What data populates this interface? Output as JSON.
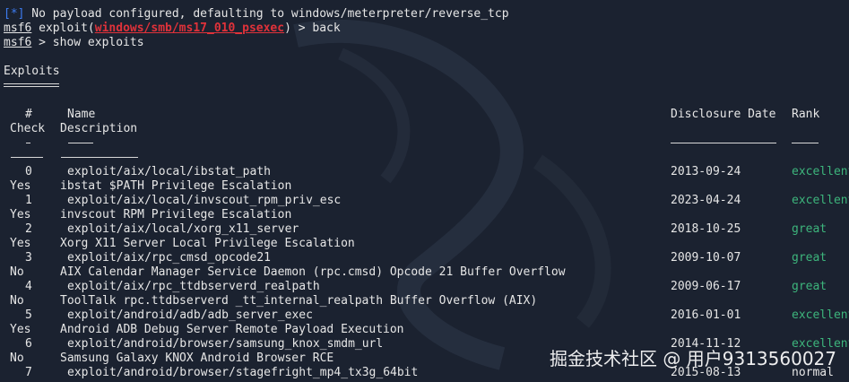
{
  "terminal": {
    "line1": {
      "marker": "[*]",
      "text": " No payload configured, defaulting to windows/meterpreter/reverse_tcp"
    },
    "line2": {
      "prompt": "msf6",
      "pre": " exploit(",
      "module": "windows/smb/ms17_010_psexec",
      "post": ") > back"
    },
    "line3": {
      "prompt": "msf6",
      "text": " > show exploits"
    },
    "section_title": "Exploits"
  },
  "table": {
    "headers": {
      "num": "#",
      "check": "Check",
      "name": "Name",
      "description": "Description",
      "date": "Disclosure Date",
      "rank": "Rank"
    },
    "rows": [
      {
        "num": "0",
        "name": "exploit/aix/local/ibstat_path",
        "date": "2013-09-24",
        "rank": "excellent",
        "check": "Yes",
        "description": "ibstat $PATH Privilege Escalation"
      },
      {
        "num": "1",
        "name": "exploit/aix/local/invscout_rpm_priv_esc",
        "date": "2023-04-24",
        "rank": "excellent",
        "check": "Yes",
        "description": "invscout RPM Privilege Escalation"
      },
      {
        "num": "2",
        "name": "exploit/aix/local/xorg_x11_server",
        "date": "2018-10-25",
        "rank": "great",
        "check": "Yes",
        "description": "Xorg X11 Server Local Privilege Escalation"
      },
      {
        "num": "3",
        "name": "exploit/aix/rpc_cmsd_opcode21",
        "date": "2009-10-07",
        "rank": "great",
        "check": "No",
        "description": "AIX Calendar Manager Service Daemon (rpc.cmsd) Opcode 21 Buffer Overflow"
      },
      {
        "num": "4",
        "name": "exploit/aix/rpc_ttdbserverd_realpath",
        "date": "2009-06-17",
        "rank": "great",
        "check": "No",
        "description": "ToolTalk rpc.ttdbserverd _tt_internal_realpath Buffer Overflow (AIX)"
      },
      {
        "num": "5",
        "name": "exploit/android/adb/adb_server_exec",
        "date": "2016-01-01",
        "rank": "excellent",
        "check": "Yes",
        "description": "Android ADB Debug Server Remote Payload Execution"
      },
      {
        "num": "6",
        "name": "exploit/android/browser/samsung_knox_smdm_url",
        "date": "2014-11-12",
        "rank": "excellent",
        "check": "No",
        "description": "Samsung Galaxy KNOX Android Browser RCE"
      },
      {
        "num": "7",
        "name": "exploit/android/browser/stagefright_mp4_tx3g_64bit",
        "date": "2015-08-13",
        "rank": "normal",
        "check": "",
        "description": ""
      }
    ]
  },
  "colors": {
    "background": "#1b2230",
    "prompt_blue": "#3d7cf0",
    "module_red": "#e0323a",
    "rank_green": "#3db57c"
  },
  "watermark": "掘金技术社区 @ 用户9313560027"
}
